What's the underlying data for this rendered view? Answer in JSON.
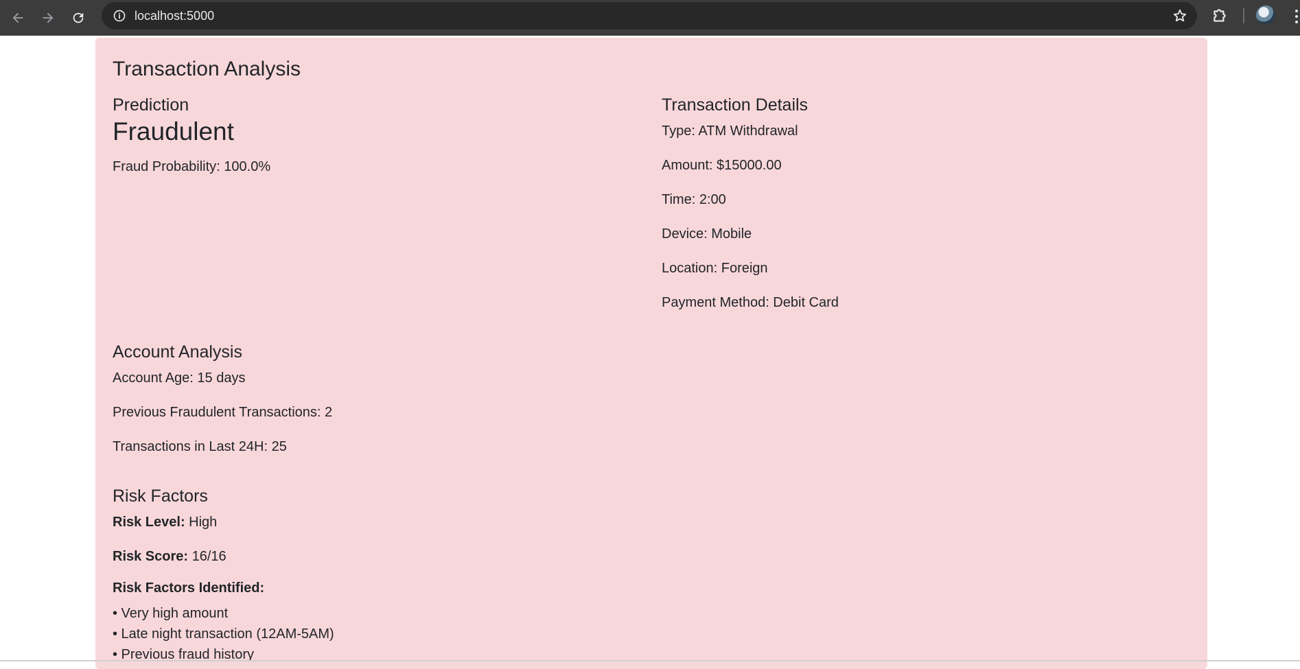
{
  "browser": {
    "url": "localhost:5000"
  },
  "page": {
    "title": "Transaction Analysis",
    "prediction": {
      "heading": "Prediction",
      "result": "Fraudulent",
      "probability": "Fraud Probability: 100.0%"
    },
    "details": {
      "heading": "Transaction Details",
      "type": "Type: ATM Withdrawal",
      "amount": "Amount: $15000.00",
      "time": "Time: 2:00",
      "device": "Device: Mobile",
      "location": "Location: Foreign",
      "payment": "Payment Method: Debit Card"
    },
    "account": {
      "heading": "Account Analysis",
      "age": "Account Age: 15 days",
      "prev_fraud": "Previous Fraudulent Transactions: 2",
      "tx_24h": "Transactions in Last 24H: 25"
    },
    "risk": {
      "heading": "Risk Factors",
      "level_label": "Risk Level:",
      "level_value": " High",
      "score_label": "Risk Score:",
      "score_value": " 16/16",
      "identified_label": "Risk Factors Identified:",
      "factors": [
        "• Very high amount",
        "• Late night transaction (12AM-5AM)",
        "• Previous fraud history"
      ]
    }
  },
  "colors": {
    "card_bg": "#f8d7da",
    "text": "#212529",
    "chrome_bg": "#3c3c3c"
  }
}
